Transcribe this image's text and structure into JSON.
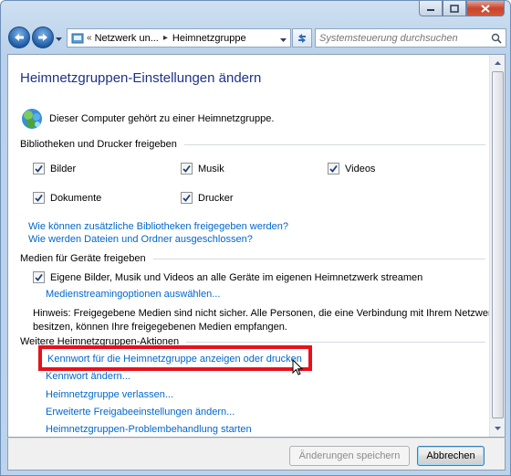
{
  "window": {
    "caption_buttons": [
      "minimize-icon",
      "maximize-icon",
      "close-icon"
    ]
  },
  "address_bar": {
    "overflow_chevron": "«",
    "segments": [
      "Netzwerk un...",
      "Heimnetzgruppe"
    ],
    "search_placeholder": "Systemsteuerung durchsuchen"
  },
  "page": {
    "title": "Heimnetzgruppen-Einstellungen ändern",
    "membership_text": "Dieser Computer gehört zu einer Heimnetzgruppe."
  },
  "libraries": {
    "heading": "Bibliotheken und Drucker freigeben",
    "items": [
      {
        "label": "Bilder",
        "checked": true
      },
      {
        "label": "Musik",
        "checked": true
      },
      {
        "label": "Videos",
        "checked": true
      },
      {
        "label": "Dokumente",
        "checked": true
      },
      {
        "label": "Drucker",
        "checked": true
      }
    ],
    "links": [
      "Wie können zusätzliche Bibliotheken freigegeben werden?",
      "Wie werden Dateien und Ordner ausgeschlossen?"
    ]
  },
  "media": {
    "heading": "Medien für Geräte freigeben",
    "stream_label": "Eigene Bilder, Musik und Videos an alle Geräte im eigenen Heimnetzwerk streamen",
    "stream_checked": true,
    "options_link": "Medienstreamingoptionen auswählen...",
    "note_line1": "Hinweis: Freigegebene Medien sind nicht sicher. Alle Personen, die eine Verbindung mit Ihrem Netzwerk",
    "note_line2": "besitzen, können Ihre freigegebenen Medien empfangen."
  },
  "actions": {
    "heading": "Weitere Heimnetzgruppen-Aktionen",
    "links": [
      "Kennwort für die Heimnetzgruppe anzeigen oder drucken",
      "Kennwort ändern...",
      "Heimnetzgruppe verlassen...",
      "Erweiterte Freigabeeinstellungen ändern...",
      "Heimnetzgruppen-Problembehandlung starten"
    ]
  },
  "buttons": {
    "save": "Änderungen speichern",
    "cancel": "Abbrechen"
  },
  "colors": {
    "title": "#1e3287",
    "link": "#0066cc",
    "highlight": "#e8101b"
  }
}
